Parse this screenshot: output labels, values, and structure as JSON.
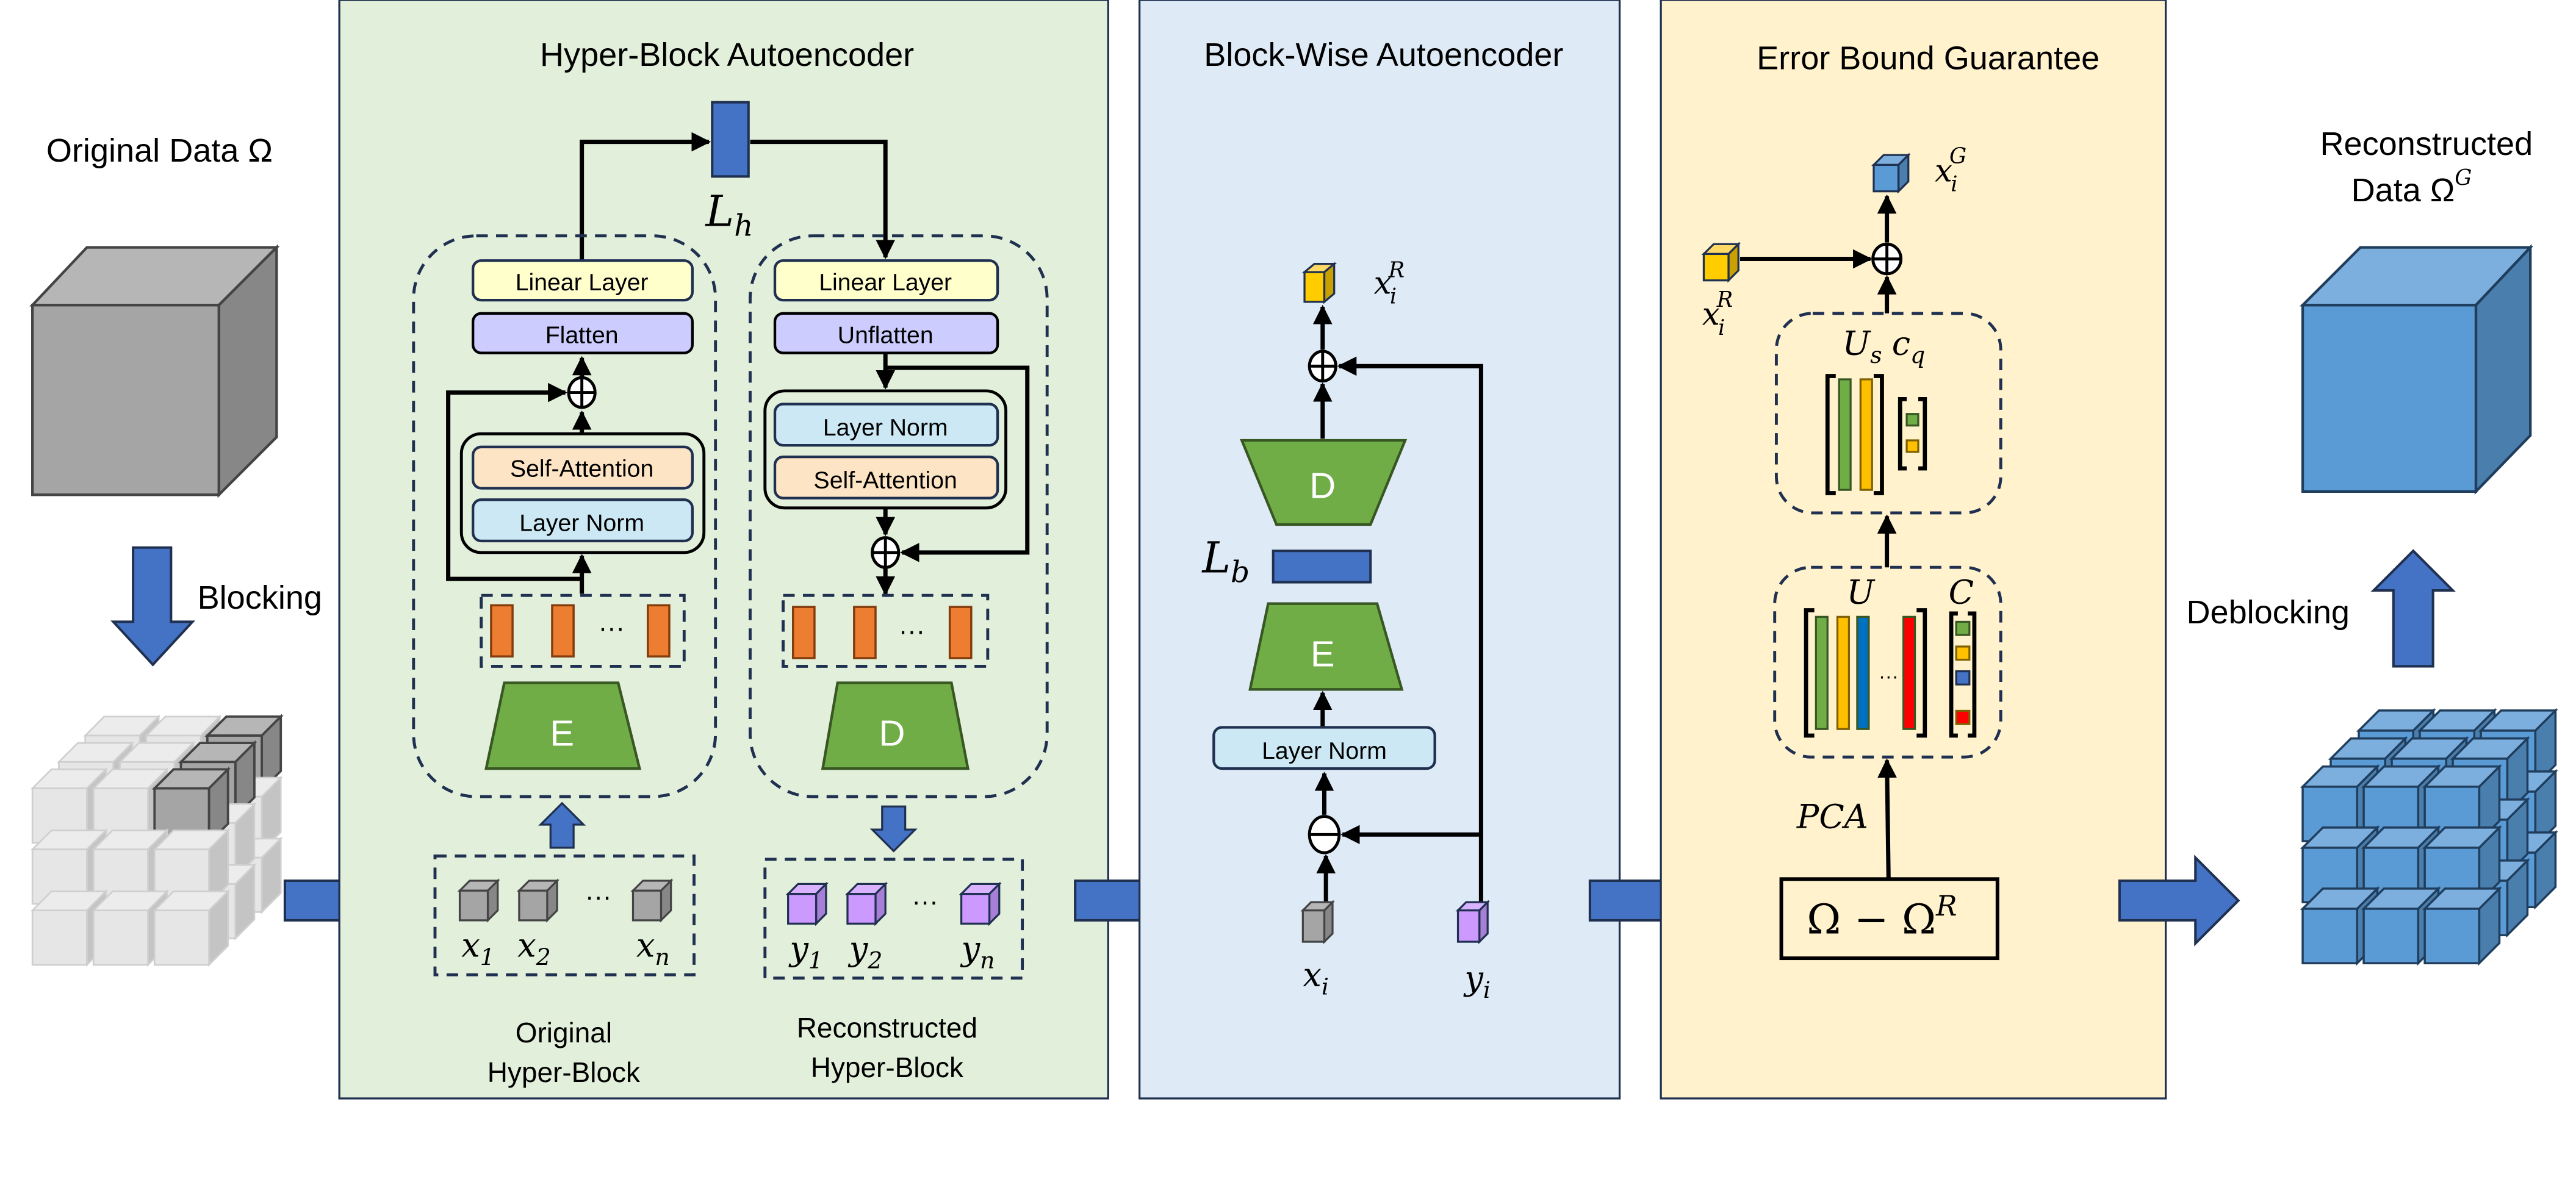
{
  "left": {
    "original_label": "Original Data Ω",
    "blocking_label": "Blocking"
  },
  "right": {
    "reconstructed_label_line1": "Reconstructed",
    "reconstructed_label_line2": "Data Ω",
    "reconstructed_label_sup": "G",
    "deblocking_label": "Deblocking"
  },
  "panels": {
    "hyper": {
      "title": "Hyper-Block Autoencoder",
      "latent_label": "L",
      "latent_sub": "h",
      "encoder": {
        "linear": "Linear Layer",
        "flatten": "Flatten",
        "self_attention": "Self-Attention",
        "layer_norm": "Layer Norm",
        "block": "E"
      },
      "decoder": {
        "linear": "Linear Layer",
        "unflatten": "Unflatten",
        "layer_norm": "Layer Norm",
        "self_attention": "Self-Attention",
        "block": "D"
      },
      "ellipsis": "···",
      "original_caption_1": "Original",
      "original_caption_2": "Hyper-Block",
      "recon_caption_1": "Reconstructed",
      "recon_caption_2": "Hyper-Block",
      "x_labels": [
        {
          "b": "x",
          "s": "1"
        },
        {
          "b": "x",
          "s": "2"
        },
        {
          "b": "x",
          "s": "n"
        }
      ],
      "y_labels": [
        {
          "b": "y",
          "s": "1"
        },
        {
          "b": "y",
          "s": "2"
        },
        {
          "b": "y",
          "s": "n"
        }
      ]
    },
    "blockwise": {
      "title": "Block-Wise Autoencoder",
      "decoder": "D",
      "encoder": "E",
      "latent_label": "L",
      "latent_sub": "b",
      "layer_norm": "Layer Norm",
      "output_label": "x",
      "output_sub": "i",
      "output_sup": "R",
      "x_label": "x",
      "x_sub": "i",
      "y_label": "y",
      "y_sub": "i"
    },
    "error": {
      "title": "Error Bound Guarantee",
      "out_label": "x",
      "out_sub": "i",
      "out_sup": "G",
      "in_label": "x",
      "in_sub": "i",
      "in_sup": "R",
      "us_label": "U",
      "us_sub": "s",
      "cq_label": "c",
      "cq_sub": "q",
      "u_label": "U",
      "c_label": "C",
      "pca_label": "PCA",
      "residual_label": "Ω − Ω",
      "residual_sup": "R",
      "ellipsis": "···"
    }
  },
  "colors": {
    "hyper_bg": "#e2efda",
    "blockwise_bg": "#deebf7",
    "error_bg": "#fff2cc",
    "arrow_blue": "#4472c4",
    "green_block": "#70ad47",
    "linear_yellow": "#ffffcc",
    "flatten_purple": "#ccccff",
    "attention_orange": "#fce4c4",
    "norm_blue": "#cce8f4",
    "token_orange": "#ed7d31",
    "cube_gray": "#a6a6a6",
    "cube_purple": "#cc99ff",
    "cube_yellow": "#ffcc00",
    "cube_blue": "#5b9bd5"
  }
}
